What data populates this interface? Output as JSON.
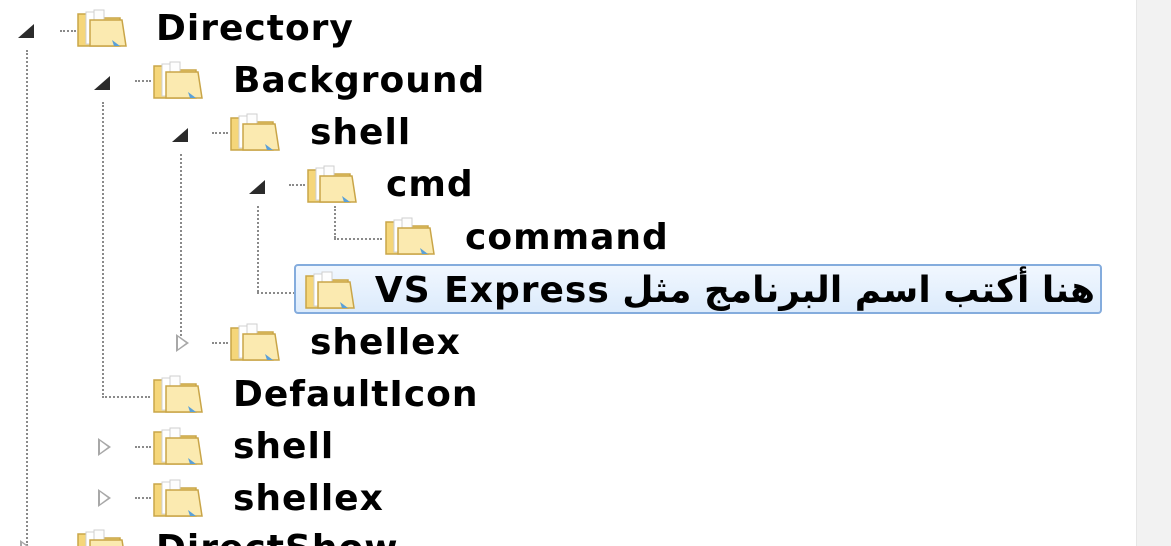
{
  "tree": {
    "nodes": [
      {
        "id": "directory",
        "label": "Directory",
        "expander": "expanded"
      },
      {
        "id": "background",
        "label": "Background",
        "expander": "expanded"
      },
      {
        "id": "shell-bg",
        "label": "shell",
        "expander": "expanded"
      },
      {
        "id": "cmd",
        "label": "cmd",
        "expander": "expanded"
      },
      {
        "id": "command",
        "label": "command",
        "expander": "none"
      },
      {
        "id": "vs-express",
        "label": "هنا أكتب اسم البرنامج مثل VS Express",
        "expander": "none",
        "selected": true
      },
      {
        "id": "shellex-bg",
        "label": "shellex",
        "expander": "collapsed"
      },
      {
        "id": "defaulticon",
        "label": "DefaultIcon",
        "expander": "none"
      },
      {
        "id": "shell",
        "label": "shell",
        "expander": "collapsed"
      },
      {
        "id": "shellex",
        "label": "shellex",
        "expander": "collapsed"
      },
      {
        "id": "directshow",
        "label": "DirectShow",
        "expander": "expanded"
      }
    ]
  },
  "colors": {
    "selection_border": "#84acdd",
    "selection_fill": "#dcebfc",
    "folder_fill": "#f5d67a",
    "folder_light": "#fbeab0",
    "tree_lines": "#8a8a8a"
  },
  "icons": {
    "folder": "folder-icon",
    "expanded": "triangle-expanded-icon",
    "collapsed": "triangle-collapsed-icon"
  }
}
